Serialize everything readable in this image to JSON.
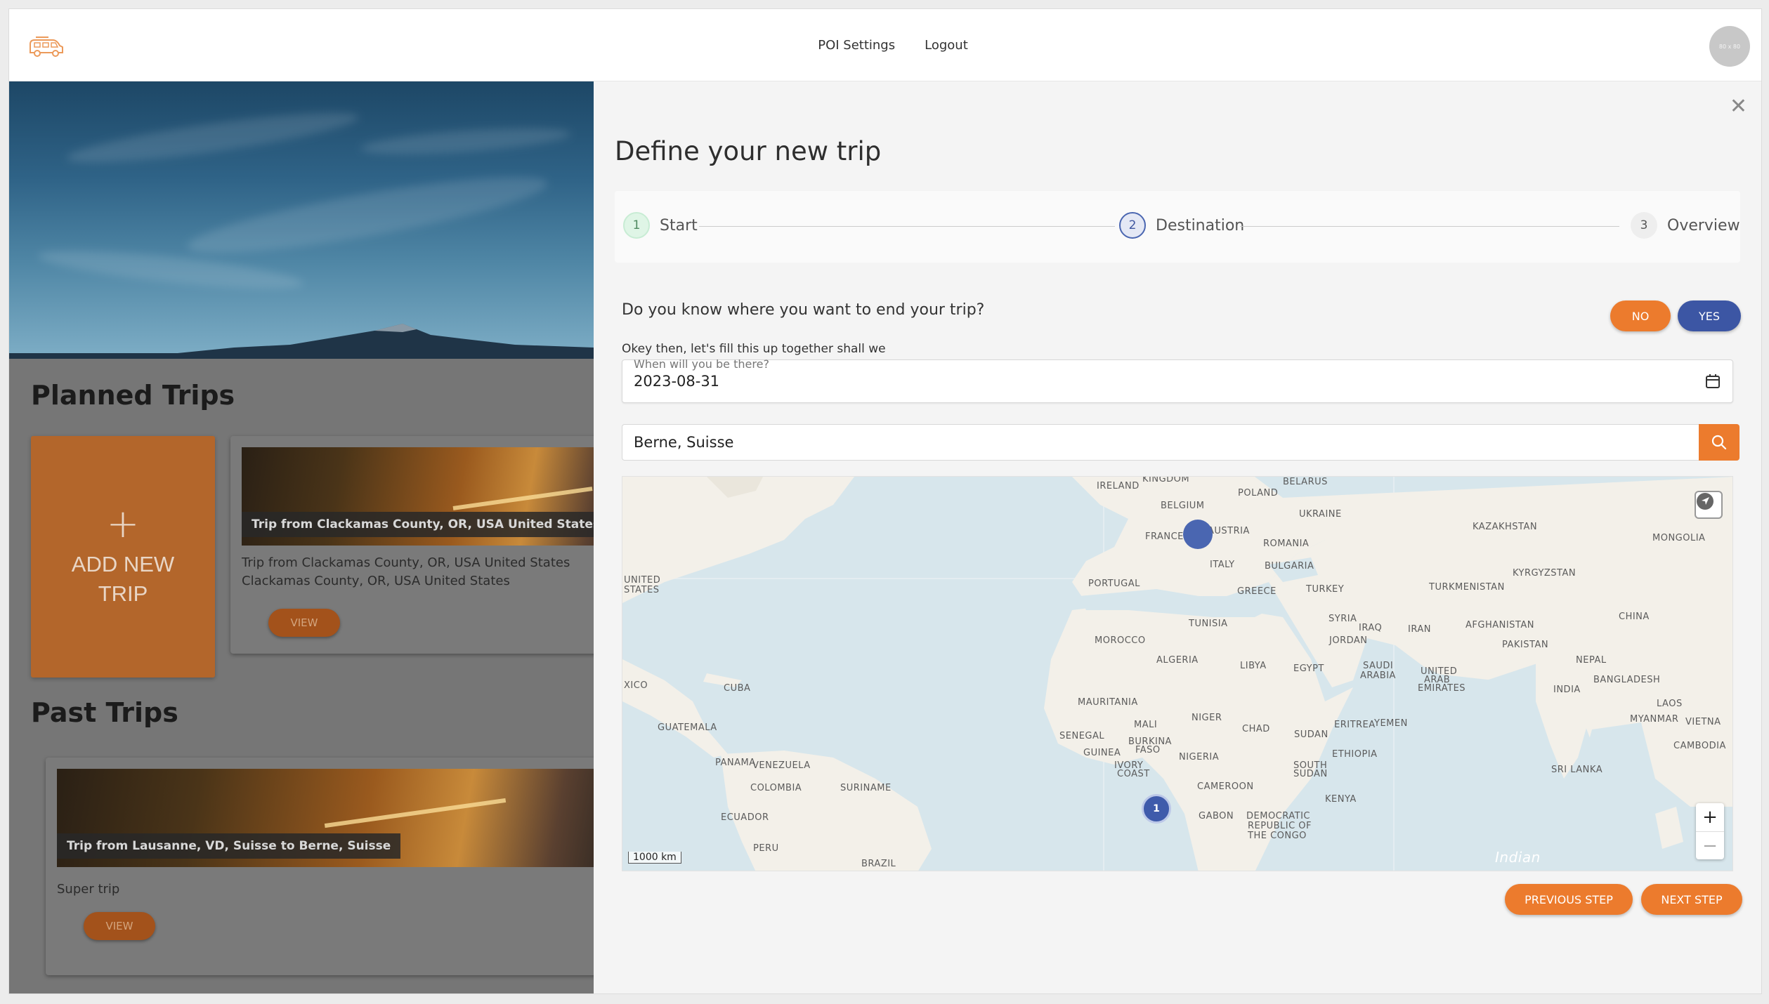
{
  "header": {
    "nav": [
      "POI Settings",
      "Logout"
    ],
    "avatar_text": "80 x 80"
  },
  "planned": {
    "title": "Planned Trips",
    "add_trip_label": "ADD NEW TRIP",
    "card": {
      "caption": "Trip from Clackamas County, OR, USA United States Clackamas County",
      "description": "Trip from Clackamas County, OR, USA United States Clackamas County, OR, USA United States",
      "button": "VIEW"
    }
  },
  "past": {
    "title": "Past Trips",
    "card": {
      "caption": "Trip from Lausanne, VD, Suisse to Berne, Suisse",
      "description": "Super trip",
      "button": "VIEW"
    }
  },
  "drawer": {
    "title": "Define your new trip",
    "steps": [
      {
        "num": "1",
        "label": "Start"
      },
      {
        "num": "2",
        "label": "Destination"
      },
      {
        "num": "3",
        "label": "Overview"
      }
    ],
    "question": "Do you know where you want to end your trip?",
    "no_label": "NO",
    "yes_label": "YES",
    "info": "Okey then, let's fill this up together shall we",
    "date_label": "When will you be there?",
    "date_value": "2023-08-31",
    "search_value": "Berne, Suisse",
    "prev_label": "PREVIOUS STEP",
    "next_label": "NEXT STEP"
  },
  "map": {
    "scale": "1000 km",
    "cluster_count": "1",
    "labels": [
      "KINGDOM",
      "IRELAND",
      "BELARUS",
      "BELGIUM",
      "POLAND",
      "UKRAINE",
      "AUSTRIA",
      "FRANCE",
      "ROMANIA",
      "KAZAKHSTAN",
      "MONGOLIA",
      "ITALY",
      "BULGARIA",
      "PORTUGAL",
      "GREECE",
      "TURKEY",
      "KYRGYZSTAN",
      "TURKMENISTAN",
      "UNITED STATES",
      "TUNISIA",
      "SYRIA",
      "IRAQ",
      "IRAN",
      "AFGHANISTAN",
      "CHINA",
      "MOROCCO",
      "JORDAN",
      "PAKISTAN",
      "ALGERIA",
      "LIBYA",
      "EGYPT",
      "SAUDI ARABIA",
      "UNITED ARAB EMIRATES",
      "NEPAL",
      "BANGLADESH",
      "MEXICO",
      "CUBA",
      "INDIA",
      "MAURITANIA",
      "MALI",
      "NIGER",
      "CHAD",
      "SUDAN",
      "ERITREA",
      "YEMEN",
      "LAOS",
      "MYANMAR",
      "VIETNAM",
      "GUATEMALA",
      "SENEGAL",
      "BURKINA FASO",
      "CAMBODIA",
      "GUINEA",
      "NIGERIA",
      "ETHIOPIA",
      "PANAMA",
      "VENEZUELA",
      "IVORY COAST",
      "SOUTH SUDAN",
      "SRI LANKA",
      "COLOMBIA",
      "SURINAME",
      "CAMEROON",
      "KENYA",
      "ECUADOR",
      "GABON",
      "DEMOCRATIC REPUBLIC OF THE CONGO",
      "PERU",
      "BRAZIL",
      "Indian"
    ]
  }
}
